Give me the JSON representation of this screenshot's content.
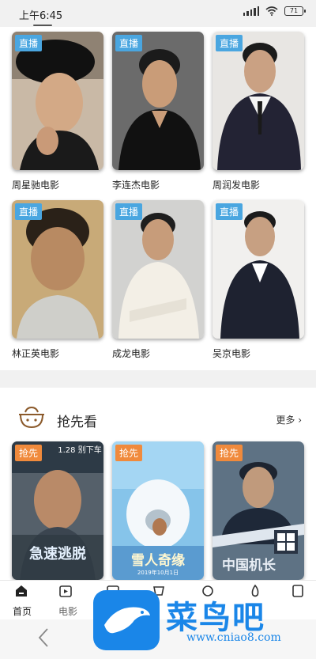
{
  "status_bar": {
    "time": "上午6:45",
    "battery": "71"
  },
  "stars": {
    "tag_label": "直播",
    "items": [
      {
        "caption": "周星驰电影"
      },
      {
        "caption": "李连杰电影"
      },
      {
        "caption": "周润发电影"
      },
      {
        "caption": "林正英电影"
      },
      {
        "caption": "成龙电影"
      },
      {
        "caption": "吴京电影"
      }
    ]
  },
  "preview": {
    "title": "抢先看",
    "more_label": "更多",
    "tag_label": "抢先",
    "posters": [
      {
        "title_text": "急速逃脱",
        "top_text": "1.28 别下车"
      },
      {
        "title_text": "雪人奇缘",
        "top_text": "2019年10月1日"
      },
      {
        "title_text": "中国机长",
        "top_text": ""
      }
    ]
  },
  "bottom_nav": {
    "items": [
      {
        "label": "首页",
        "icon": "home-icon"
      },
      {
        "label": "电影",
        "icon": "movie-icon"
      },
      {
        "label": "",
        "icon": "tv-icon"
      },
      {
        "label": "",
        "icon": "variety-icon"
      },
      {
        "label": "",
        "icon": "music-icon"
      },
      {
        "label": "",
        "icon": "fire-icon"
      },
      {
        "label": "",
        "icon": "user-icon"
      }
    ]
  },
  "watermark": {
    "text": "菜鸟吧",
    "url": "www.cniao8.com"
  },
  "colors": {
    "live_tag": "#4aa6e0",
    "preview_tag": "#f08a3c",
    "brand": "#1a86e8"
  }
}
